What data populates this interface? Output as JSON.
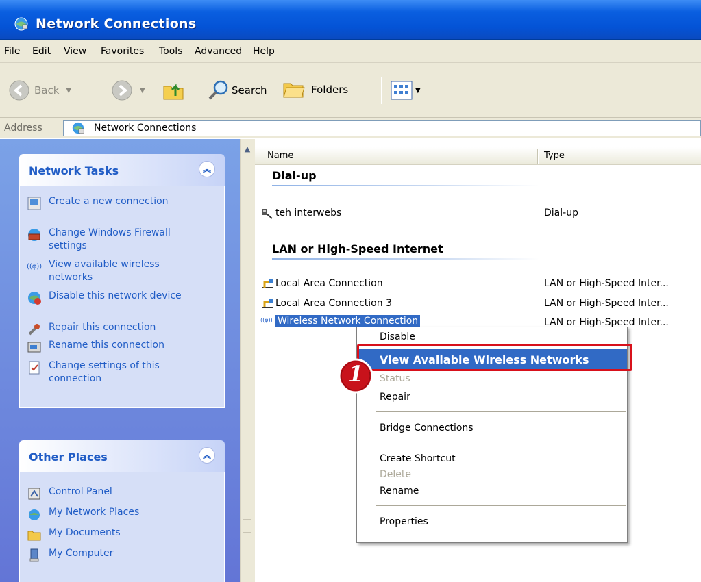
{
  "window": {
    "title": "Network Connections"
  },
  "menubar": {
    "items": [
      "File",
      "Edit",
      "View",
      "Favorites",
      "Tools",
      "Advanced",
      "Help"
    ]
  },
  "toolbar": {
    "back_label": "Back",
    "search_label": "Search",
    "folders_label": "Folders"
  },
  "address": {
    "label": "Address",
    "value": "Network Connections"
  },
  "network_tasks": {
    "title": "Network Tasks",
    "items": [
      "Create a new connection",
      "Change Windows Firewall settings",
      "View available wireless networks",
      "Disable this network device",
      "Repair this connection",
      "Rename this connection",
      "Change settings of this connection"
    ]
  },
  "other_places": {
    "title": "Other Places",
    "items": [
      "Control Panel",
      "My Network Places",
      "My Documents",
      "My Computer"
    ]
  },
  "file_list": {
    "columns": [
      "Name",
      "Type"
    ],
    "groups": [
      {
        "title": "Dial-up",
        "rows": [
          {
            "name": "teh interwebs",
            "type": "Dial-up"
          }
        ]
      },
      {
        "title": "LAN or High-Speed Internet",
        "rows": [
          {
            "name": "Local Area Connection",
            "type": "LAN or High-Speed Inter..."
          },
          {
            "name": "Local Area Connection 3",
            "type": "LAN or High-Speed Inter..."
          },
          {
            "name": "Wireless Network Connection",
            "type": "LAN or High-Speed Inter..."
          }
        ]
      }
    ]
  },
  "context_menu": {
    "items": [
      "Disable",
      "View Available Wireless Networks",
      "Status",
      "Repair",
      "Bridge Connections",
      "Create Shortcut",
      "Delete",
      "Rename",
      "Properties"
    ]
  },
  "callout": {
    "number": "1",
    "color": "#d8111b"
  },
  "colors": {
    "titlebar": "#0453d6",
    "link": "#215dc6",
    "selection": "#316ac5",
    "chrome": "#ece9d8"
  }
}
